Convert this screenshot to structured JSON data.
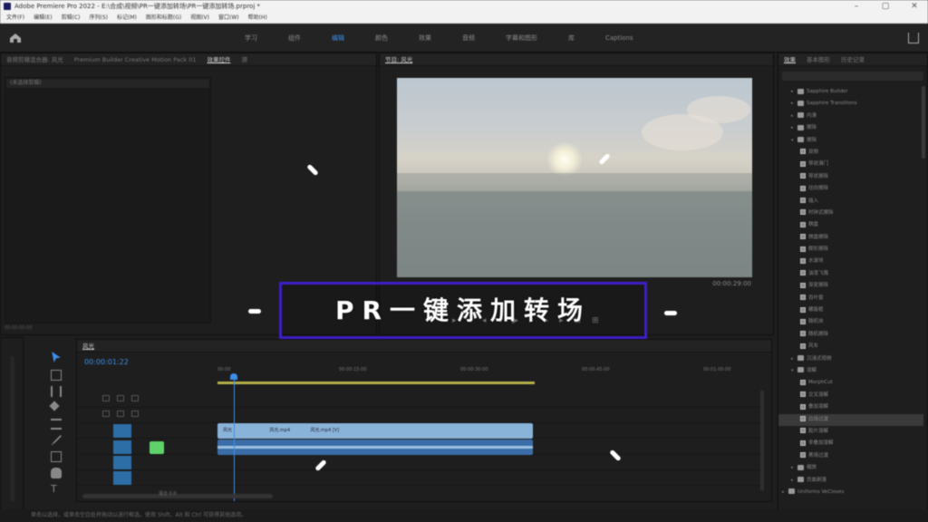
{
  "titlebar": {
    "title": "Adobe Premiere Pro 2022 - E:\\合成\\视频\\PR一键添加转场\\PR一键添加转场.prproj *"
  },
  "menu": [
    "文件(F)",
    "编辑(E)",
    "剪辑(C)",
    "序列(S)",
    "标记(M)",
    "图形和标题(G)",
    "视图(V)",
    "窗口(W)",
    "帮助(H)"
  ],
  "workspace": {
    "tabs": [
      "学习",
      "组件",
      "编辑",
      "颜色",
      "效果",
      "音频",
      "字幕和图形",
      "库",
      "Captions"
    ],
    "active_index": 2
  },
  "source_panel": {
    "tabs": [
      "音频剪辑混合器: 风光",
      "Premium Builder Creative Motion Pack 01",
      "效果控件",
      "源"
    ],
    "active_index": 2,
    "dropdown": "(未选择剪辑)",
    "status": "00:00:00:00"
  },
  "program_panel": {
    "tab": "节目: 风光",
    "timecode": "00:00:29:00",
    "transport": [
      "▸",
      "◂◂",
      "◂",
      "▶",
      "▸",
      "▸▸",
      "⊡",
      "⊞"
    ]
  },
  "right_panel": {
    "tabs": [
      "效果",
      "基本图形",
      "历史记录"
    ],
    "tree": [
      {
        "label": "Sapphire Builder",
        "type": "folder",
        "expanded": false,
        "indent": 1
      },
      {
        "label": "Sapphire Transitions",
        "type": "folder",
        "expanded": false,
        "indent": 1
      },
      {
        "label": "内滑",
        "type": "folder",
        "expanded": false,
        "indent": 1
      },
      {
        "label": "擦除",
        "type": "folder",
        "expanded": false,
        "indent": 1
      },
      {
        "label": "擦除",
        "type": "folder",
        "expanded": true,
        "indent": 1
      },
      {
        "label": "双侧",
        "type": "item",
        "indent": 2
      },
      {
        "label": "带状滑门",
        "type": "item",
        "indent": 2
      },
      {
        "label": "带状擦除",
        "type": "item",
        "indent": 2
      },
      {
        "label": "径向擦除",
        "type": "item",
        "indent": 2
      },
      {
        "label": "插入",
        "type": "item",
        "indent": 2
      },
      {
        "label": "时钟式擦除",
        "type": "item",
        "indent": 2
      },
      {
        "label": "棋盘",
        "type": "item",
        "indent": 2
      },
      {
        "label": "棋盘擦除",
        "type": "item",
        "indent": 2
      },
      {
        "label": "楔形擦除",
        "type": "item",
        "indent": 2
      },
      {
        "label": "水波块",
        "type": "item",
        "indent": 2
      },
      {
        "label": "油漆飞溅",
        "type": "item",
        "indent": 2
      },
      {
        "label": "渐变擦除",
        "type": "item",
        "indent": 2
      },
      {
        "label": "百叶窗",
        "type": "item",
        "indent": 2
      },
      {
        "label": "螺旋框",
        "type": "item",
        "indent": 2
      },
      {
        "label": "随机块",
        "type": "item",
        "indent": 2
      },
      {
        "label": "随机擦除",
        "type": "item",
        "indent": 2
      },
      {
        "label": "风车",
        "type": "item",
        "indent": 2
      },
      {
        "label": "沉浸式视频",
        "type": "folder",
        "expanded": false,
        "indent": 1
      },
      {
        "label": "溶解",
        "type": "folder",
        "expanded": true,
        "indent": 1
      },
      {
        "label": "MorphCut",
        "type": "item",
        "indent": 2
      },
      {
        "label": "交叉溶解",
        "type": "item",
        "indent": 2
      },
      {
        "label": "叠加溶解",
        "type": "item",
        "indent": 2
      },
      {
        "label": "白场过渡",
        "type": "item",
        "indent": 2,
        "selected": true
      },
      {
        "label": "胶片溶解",
        "type": "item",
        "indent": 2
      },
      {
        "label": "非叠加溶解",
        "type": "item",
        "indent": 2
      },
      {
        "label": "黑场过渡",
        "type": "item",
        "indent": 2
      },
      {
        "label": "缩放",
        "type": "folder",
        "expanded": false,
        "indent": 1
      },
      {
        "label": "页面剥落",
        "type": "folder",
        "expanded": false,
        "indent": 1
      },
      {
        "label": "Uniforms VeCloves",
        "type": "folder",
        "expanded": false,
        "indent": 0
      }
    ]
  },
  "timeline": {
    "tab": "风光",
    "timecode": "00:00:01:22",
    "ruler": [
      "00:00",
      "00:00:15:00",
      "00:00:30:00",
      "00:00:45:00",
      "00:01:00:00"
    ],
    "video_tracks": [
      "V3",
      "V2",
      "V1"
    ],
    "audio_tracks": [
      "A1",
      "A2",
      "A3"
    ],
    "mix_label": "混合",
    "mix_value": "0.0",
    "clip_labels": [
      "风光",
      "风光.mp4",
      "风光.mp4 [V]"
    ]
  },
  "status_bar": "单击以选择，或单击空白处并拖动以进行框选。使用 Shift、Alt 和 Ctrl 可获得其他选项。",
  "overlay": {
    "title": "PR一键添加转场"
  },
  "colors": {
    "accent": "#3d8ee8",
    "overlay_border": "#3f1ec7",
    "clip_video": "#8ab3da",
    "clip_audio": "#3b6ea8",
    "workbar": "#b6b04a"
  }
}
